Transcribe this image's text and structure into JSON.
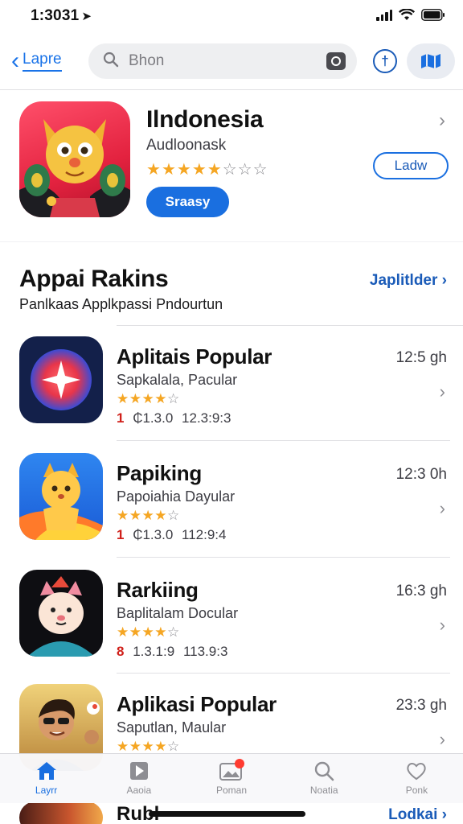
{
  "status": {
    "time": "1:3031",
    "location_glyph": "➤"
  },
  "nav": {
    "back_label": "Lapre",
    "search_placeholder": "Bhon"
  },
  "featured": {
    "title": "Ilndonesia",
    "subtitle": "Audloonask",
    "rating": 3.5,
    "button_label": "Sraasy",
    "outline_button_label": "Ladw"
  },
  "section": {
    "title": "Appai Rakins",
    "link_label": "Japlitlder ›",
    "subtitle": "Panlkaas Applkpassi Pndourtun"
  },
  "list": [
    {
      "title": "Aplitais Popular",
      "subtitle": "Sapkalala, Pacular",
      "rating": 4,
      "meta_red": "1",
      "meta_count": "₵1.3.0",
      "meta_size": "12.3:9:3",
      "time": "12:5 gh"
    },
    {
      "title": "Papiking",
      "subtitle": "Papoiahia Dayular",
      "rating": 4,
      "meta_red": "1",
      "meta_count": "₵1.3.0",
      "meta_size": "112:9:4",
      "time": "12:3 0h"
    },
    {
      "title": "Rarkiing",
      "subtitle": "Baplitalam Docular",
      "rating": 4,
      "meta_red": "8",
      "meta_count": "1.3.1:9",
      "meta_size": "113.9:3",
      "time": "16:3 gh"
    },
    {
      "title": "Aplikasi Popular",
      "subtitle": "Saputlan, Maular",
      "rating": 4,
      "time": "23:3 gh"
    }
  ],
  "tabs": [
    {
      "label": "Layrr",
      "icon": "house-icon",
      "active": true
    },
    {
      "label": "Aaoia",
      "icon": "play-tile-icon",
      "active": false
    },
    {
      "label": "Poman",
      "icon": "photo-tile-icon",
      "active": false,
      "badge": true
    },
    {
      "label": "Noatia",
      "icon": "search-icon",
      "active": false
    },
    {
      "label": "Ponk",
      "icon": "heart-icon",
      "active": false
    }
  ],
  "peek": {
    "title": "Rubl",
    "link_label": "Lodkai ›"
  },
  "colors": {
    "accent": "#1a6fe0",
    "star": "#f5a623",
    "badge": "#ff3b30"
  }
}
